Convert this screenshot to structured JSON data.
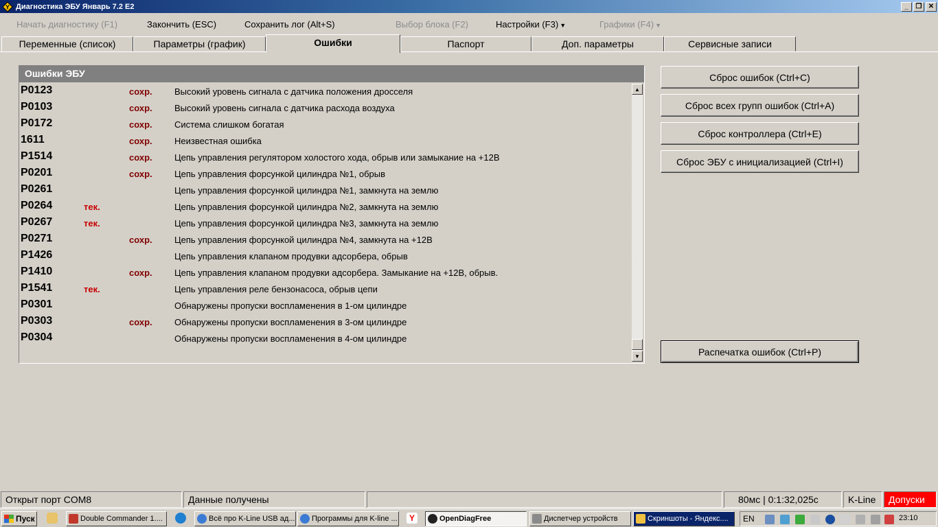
{
  "window": {
    "title": "Диагностика ЭБУ Январь 7.2 E2",
    "buttons": [
      "_",
      "❐",
      "✕"
    ]
  },
  "menu": {
    "start_diag": "Начать диагностику (F1)",
    "finish": "Закончить (ESC)",
    "save_log": "Сохранить лог (Alt+S)",
    "select_block": "Выбор блока (F2)",
    "settings": "Настройки (F3)",
    "graphs": "Графики (F4)"
  },
  "tabs": [
    {
      "label": "Переменные (список)"
    },
    {
      "label": "Параметры (график)"
    },
    {
      "label": "Ошибки"
    },
    {
      "label": "Паспорт"
    },
    {
      "label": "Доп. параметры"
    },
    {
      "label": "Сервисные записи"
    }
  ],
  "errors_panel": {
    "title": "Ошибки ЭБУ",
    "rows": [
      {
        "code": "P0123",
        "tek": "",
        "sohr": "сохр.",
        "desc": "Высокий уровень сигнала с датчика положения дросселя"
      },
      {
        "code": "P0103",
        "tek": "",
        "sohr": "сохр.",
        "desc": "Высокий уровень сигнала с датчика расхода воздуха"
      },
      {
        "code": "P0172",
        "tek": "",
        "sohr": "сохр.",
        "desc": "Система слишком богатая"
      },
      {
        "code": "1611",
        "tek": "",
        "sohr": "сохр.",
        "desc": "Неизвестная ошибка"
      },
      {
        "code": "P1514",
        "tek": "",
        "sohr": "сохр.",
        "desc": "Цепь управления регулятором холостого хода, обрыв или замыкание на +12В"
      },
      {
        "code": "P0201",
        "tek": "",
        "sohr": "сохр.",
        "desc": "Цепь управления форсункой цилиндра №1, обрыв"
      },
      {
        "code": "P0261",
        "tek": "",
        "sohr": "",
        "desc": "Цепь управления форсункой цилиндра №1, замкнута на землю"
      },
      {
        "code": "P0264",
        "tek": "тек.",
        "sohr": "",
        "desc": "Цепь управления форсункой цилиндра №2, замкнута на землю"
      },
      {
        "code": "P0267",
        "tek": "тек.",
        "sohr": "",
        "desc": "Цепь управления форсункой цилиндра №3, замкнута на землю"
      },
      {
        "code": "P0271",
        "tek": "",
        "sohr": "сохр.",
        "desc": "Цепь управления форсункой цилиндра №4, замкнута на +12В"
      },
      {
        "code": "P1426",
        "tek": "",
        "sohr": "",
        "desc": "Цепь управления клапаном продувки адсорбера, обрыв"
      },
      {
        "code": "P1410",
        "tek": "",
        "sohr": "сохр.",
        "desc": "Цепь управления клапаном продувки адсорбера. Замыкание на +12В, обрыв."
      },
      {
        "code": "P1541",
        "tek": "тек.",
        "sohr": "",
        "desc": "Цепь управления реле бензонасоса, обрыв цепи"
      },
      {
        "code": "P0301",
        "tek": "",
        "sohr": "",
        "desc": "Обнаружены пропуски воспламенения в 1-ом цилиндре"
      },
      {
        "code": "P0303",
        "tek": "",
        "sohr": "сохр.",
        "desc": "Обнаружены пропуски воспламенения в 3-ом цилиндре"
      },
      {
        "code": "P0304",
        "tek": "",
        "sohr": "",
        "desc": "Обнаружены пропуски воспламенения в 4-ом цилиндре"
      }
    ]
  },
  "actions": {
    "reset_errors": "Сброс ошибок (Ctrl+C)",
    "reset_all_groups": "Сброс всех групп ошибок (Ctrl+A)",
    "reset_controller": "Сброс контроллера (Ctrl+E)",
    "reset_ecu_init": "Сброс ЭБУ с инициализацией (Ctrl+I)",
    "print_errors": "Распечатка ошибок (Ctrl+P)"
  },
  "statusbar": {
    "port": "Открыт порт COM8",
    "data": "Данные получены",
    "empty": "",
    "timing": "80мс | 0:1:32,025c",
    "protocol": "K-Line",
    "tolerances": "Допуски"
  },
  "taskbar": {
    "start": "Пуск",
    "tasks": [
      {
        "label": "Double Commander 1...."
      },
      {
        "label": "Всё про K-Line USB ад..."
      },
      {
        "label": "Программы для K-line ..."
      },
      {
        "label": "OpenDiagFree"
      },
      {
        "label": "Диспетчер устройств"
      },
      {
        "label": "Скриншоты - Яндекс...."
      }
    ],
    "lang": "EN",
    "clock": "23:10"
  },
  "colors": {
    "titlebar_start": "#0a246a",
    "error_saved": "#800000",
    "error_current": "#c80000",
    "status_alert": "#ff0000"
  }
}
